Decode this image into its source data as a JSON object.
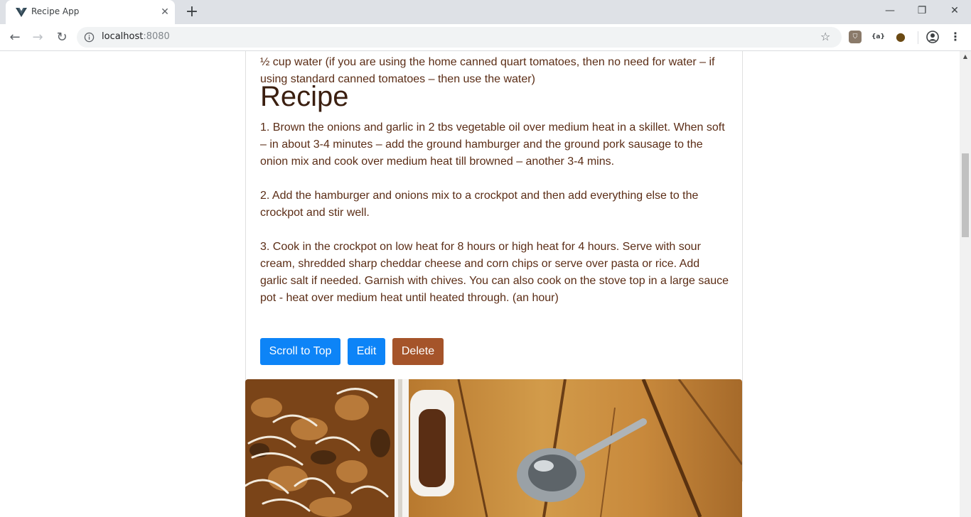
{
  "browser": {
    "tab_title": "Recipe App",
    "tab_close": "✕",
    "new_tab": "+",
    "url_host": "localhost",
    "url_port": ":8080",
    "window_controls": {
      "minimize": "—",
      "restore": "❐",
      "close": "✕"
    },
    "extensions": [
      {
        "name": "shield-extension-icon",
        "label": "⛉"
      },
      {
        "name": "json-extension-icon",
        "label": "{a}"
      },
      {
        "name": "cookie-extension-icon",
        "label": "●"
      },
      {
        "name": "profile-icon",
        "label": ""
      },
      {
        "name": "menu-icon",
        "label": "⋮"
      }
    ]
  },
  "recipe": {
    "ingredient_line": "½ cup water (if you are using the home canned quart tomatoes, then no need for water – if using standard canned tomatoes – then use the water)",
    "heading": "Recipe",
    "steps": [
      "1. Brown the onions and garlic in 2 tbs vegetable oil over medium heat in a skillet. When soft – in about 3-4 minutes – add the ground hamburger and the ground pork sausage to the onion mix and cook over medium heat till browned – another 3-4 mins.",
      "2. Add the hamburger and onions mix to a crockpot and then add everything else to the crockpot and stir well.",
      "3. Cook in the crockpot on low heat for 8 hours or high heat for 4 hours. Serve with sour cream, shredded sharp cheddar cheese and corn chips or serve over pasta or rice. Add garlic salt if needed. Garnish with chives. You can also cook on the stove top in a large sauce pot - heat over medium heat until heated through. (an hour)"
    ],
    "buttons": {
      "scroll_top": "Scroll to Top",
      "edit": "Edit",
      "delete": "Delete"
    }
  },
  "colors": {
    "primary": "#0d84f7",
    "danger_brown": "#a5542a",
    "text_brown": "#5b2d16",
    "heading_brown": "#3b1f10"
  }
}
